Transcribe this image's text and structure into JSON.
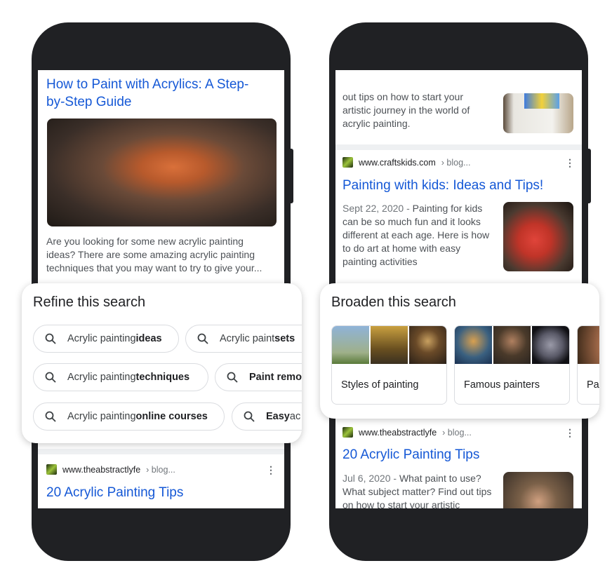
{
  "left_phone": {
    "result_title": "How to Paint with Acrylics: A Step-by-Step Guide",
    "result_snippet": "Are you looking for some new acrylic painting ideas? There are some amazing acrylic painting techniques that you may want to try to give your...",
    "refine_card": {
      "title": "Refine this search",
      "chips": [
        {
          "prefix": "Acrylic painting ",
          "bold": "ideas"
        },
        {
          "prefix": "Acrylic paint ",
          "bold": "sets"
        },
        {
          "prefix": "Acrylic painting ",
          "bold": "techniques"
        },
        {
          "prefix": "",
          "bold": "Paint remo",
          "suffix": ""
        },
        {
          "prefix": "Acrylic painting ",
          "bold": "online courses"
        },
        {
          "prefix": "",
          "bold": "Easy",
          "suffix": " ac"
        }
      ]
    },
    "next_result": {
      "site": "www.theabstractlyfe",
      "breadcrumb": "› blog...",
      "title": "20 Acrylic Painting Tips"
    }
  },
  "right_phone": {
    "top_snippet": "out tips on how to start your artistic journey in the world of acrylic painting.",
    "result": {
      "site": "www.craftskids.com",
      "breadcrumb": "› blog...",
      "title": "Painting with kids: Ideas and Tips!",
      "date": "Sept 22, 2020 - ",
      "snippet": "Painting for kids can be so much fun and it looks different at each age. Here is how to do art at home with easy painting activities"
    },
    "broaden_card": {
      "title": "Broaden this search",
      "tiles": [
        {
          "label": "Styles of painting"
        },
        {
          "label": "Famous painters"
        },
        {
          "label": "Pai"
        }
      ]
    },
    "next_result": {
      "site": "www.theabstractlyfe",
      "breadcrumb": "› blog...",
      "title": "20 Acrylic Painting Tips",
      "date": "Jul 6, 2020 - ",
      "snippet": "What paint to use? What subject matter? Find out tips on how to start your artistic"
    }
  },
  "colors": {
    "link": "#1558d6",
    "phone": "#202124"
  }
}
